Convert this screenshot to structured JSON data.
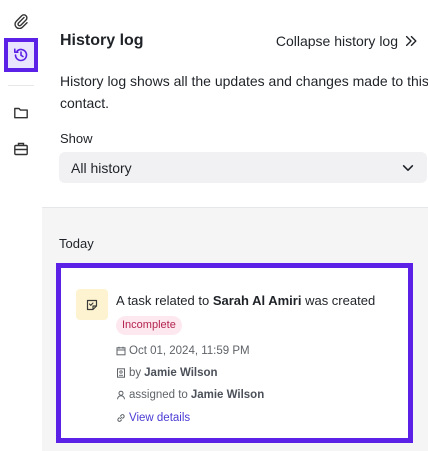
{
  "header": {
    "title": "History log",
    "collapse_label": "Collapse history log"
  },
  "description": "History log shows all the updates and changes made to this contact.",
  "filter": {
    "label": "Show",
    "selected": "All history"
  },
  "timeline": {
    "group_label": "Today",
    "entry": {
      "prefix": "A task related to ",
      "contact": "Sarah Al Amiri",
      "suffix": " was created",
      "status": "Incomplete",
      "datetime": "Oct 01, 2024, 11:59 PM",
      "by_prefix": "by ",
      "by_name": "Jamie Wilson",
      "assigned_prefix": "assigned to ",
      "assigned_name": "Jamie Wilson",
      "link_label": "View details"
    }
  },
  "colors": {
    "accent": "#5b21e6",
    "badge_bg": "#fde8ef",
    "badge_text": "#b4234f",
    "task_icon_bg": "#fdf3d0",
    "link": "#4a3cd4"
  },
  "icons": {
    "rail": [
      "paperclip-icon",
      "history-icon",
      "folder-icon",
      "briefcase-icon"
    ],
    "collapse": "double-chevron-right-icon",
    "select": "chevron-down-icon",
    "entry": [
      "task-icon",
      "calendar-icon",
      "user-card-icon",
      "user-icon",
      "link-icon"
    ]
  }
}
